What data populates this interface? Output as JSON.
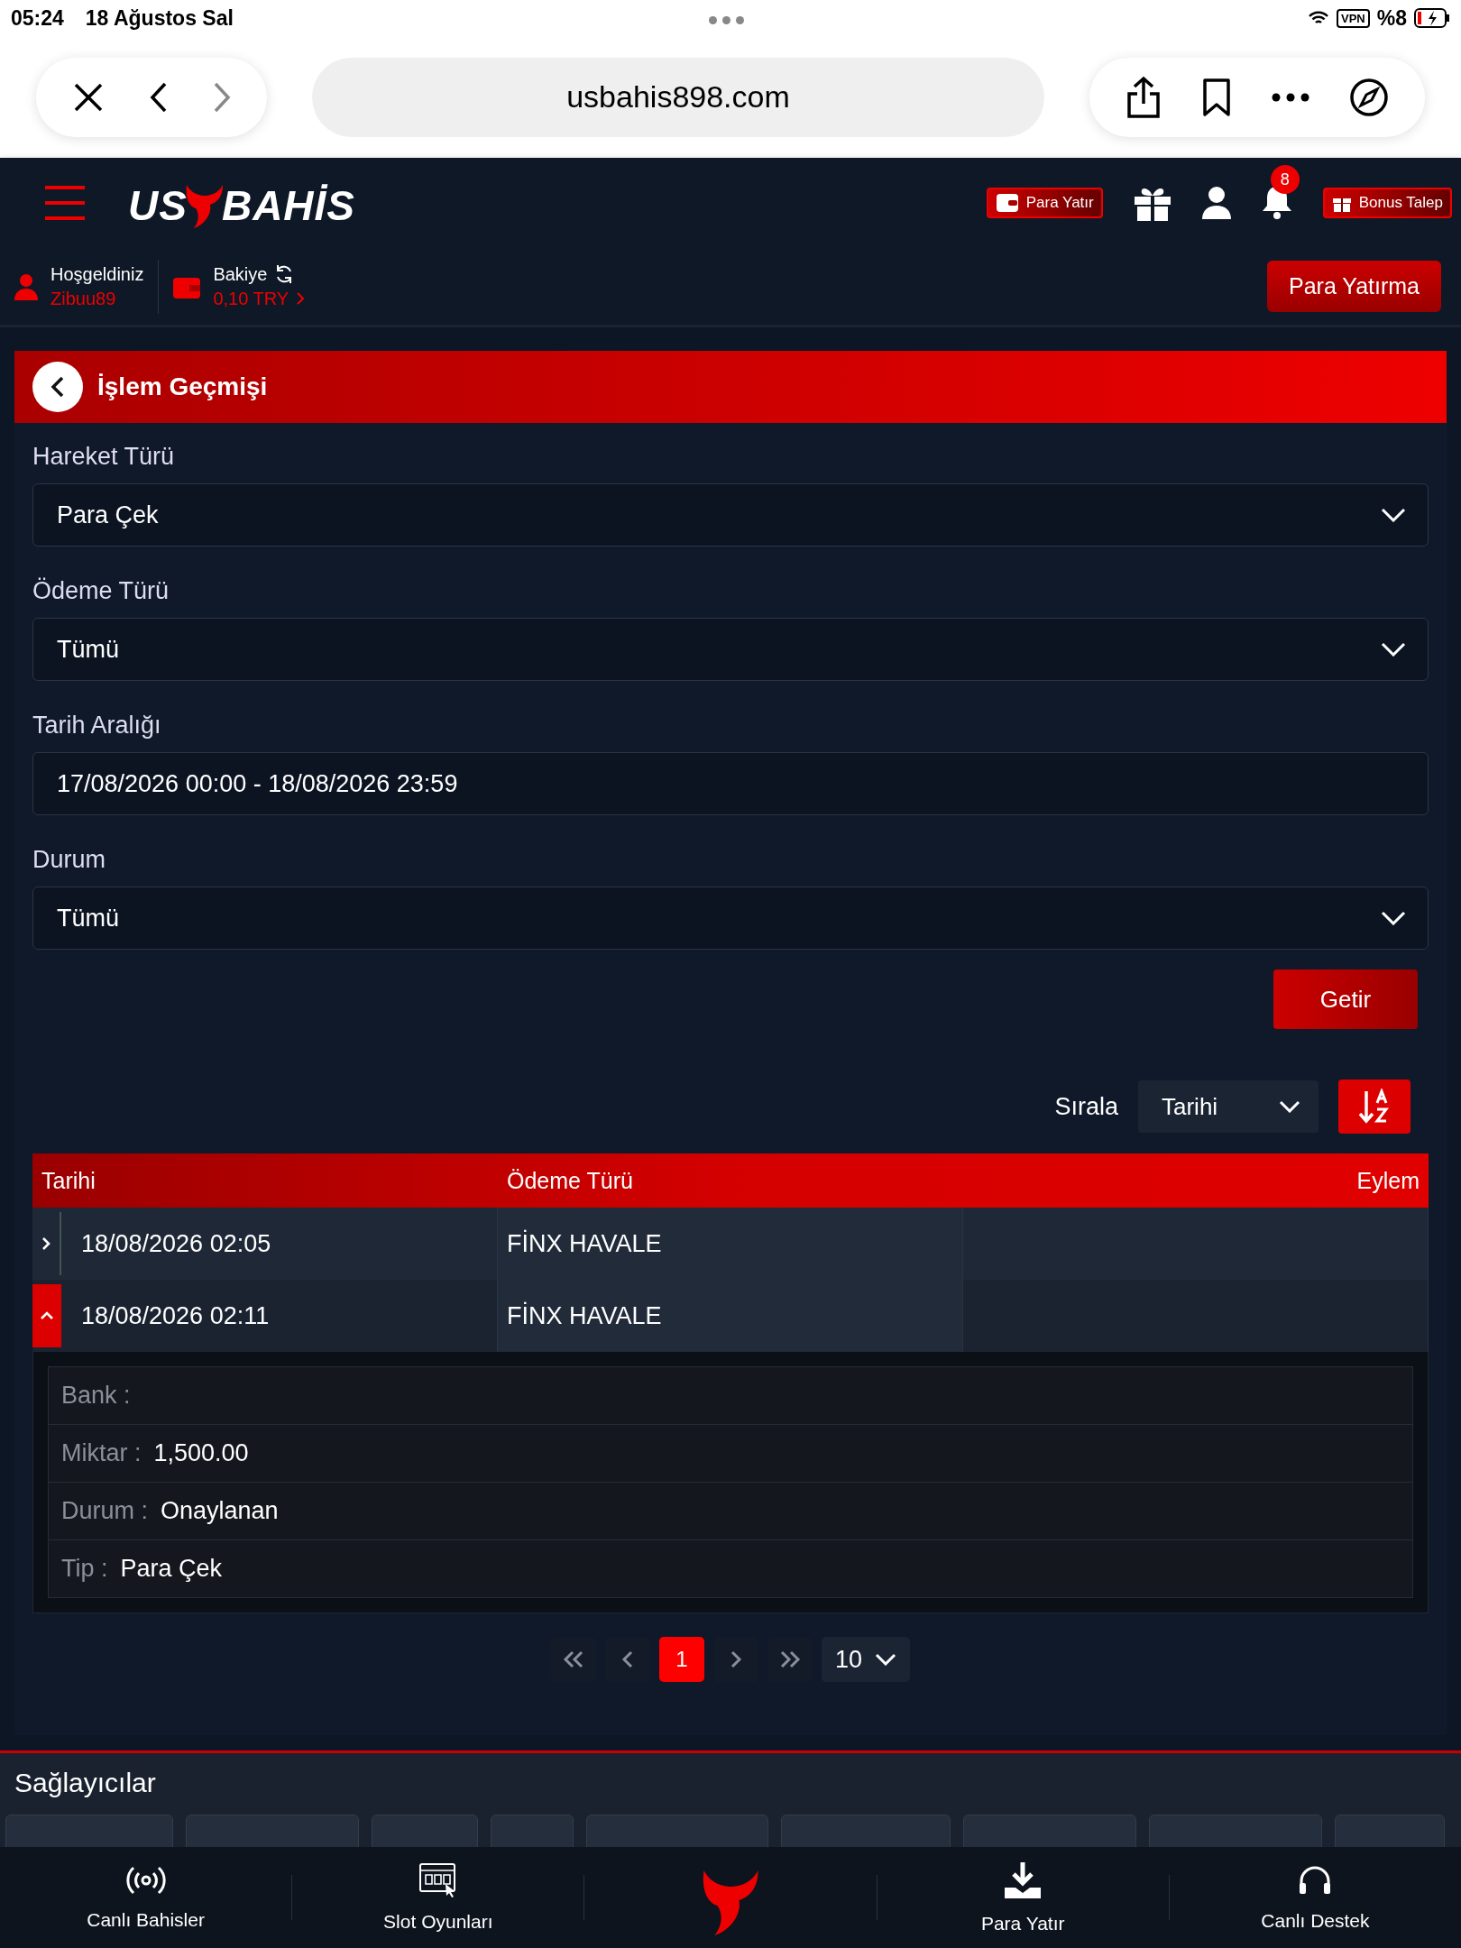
{
  "status_bar": {
    "time": "05:24",
    "date": "18 Ağustos Sal",
    "vpn": "VPN",
    "battery": "%8"
  },
  "browser": {
    "url": "usbahis898.com"
  },
  "header": {
    "logo_left": "US",
    "logo_right": "BAHİS",
    "deposit_button": "Para Yatır",
    "notification_count": "8",
    "bonus_button": "Bonus Talep"
  },
  "user_bar": {
    "greeting": "Hoşgeldiniz",
    "username": "Zibuu89",
    "balance_label": "Bakiye",
    "balance": "0,10 TRY",
    "deposit_button": "Para Yatırma"
  },
  "page": {
    "title": "İşlem Geçmişi"
  },
  "filters": [
    {
      "label": "Hareket Türü",
      "kind": "select",
      "value": "Para Çek"
    },
    {
      "label": "Ödeme Türü",
      "kind": "select",
      "value": "Tümü"
    },
    {
      "label": "Tarih Aralığı",
      "kind": "date",
      "value": "17/08/2026 00:00 - 18/08/2026 23:59"
    },
    {
      "label": "Durum",
      "kind": "select",
      "value": "Tümü"
    }
  ],
  "submit_button": "Getir",
  "sort": {
    "label": "Sırala",
    "value": "Tarihi"
  },
  "table": {
    "columns": [
      "Tarihi",
      "Ödeme Türü",
      "Eylem"
    ],
    "rows": [
      {
        "date": "18/08/2026 02:05",
        "payment": "FİNX HAVALE",
        "expanded": false
      },
      {
        "date": "18/08/2026 02:11",
        "payment": "FİNX HAVALE",
        "expanded": true,
        "details": [
          {
            "label": "Bank :"
          },
          {
            "label": "Miktar :",
            "value": "1,500.00"
          },
          {
            "label": "Durum :",
            "value": "Onaylanan"
          },
          {
            "label": "Tip :",
            "value": "Para Çek"
          }
        ]
      }
    ]
  },
  "pagination": {
    "pages": [
      {
        "label": "1",
        "selected": true
      }
    ],
    "page_size": "10"
  },
  "providers": {
    "title": "Sağlayıcılar"
  },
  "bottom_nav": [
    {
      "label": "Canlı Bahisler",
      "kind": "live"
    },
    {
      "label": "Slot Oyunları",
      "kind": "slot"
    },
    {
      "kind": "logo"
    },
    {
      "label": "Para Yatır",
      "kind": "download"
    },
    {
      "label": "Canlı Destek",
      "kind": "support"
    }
  ]
}
